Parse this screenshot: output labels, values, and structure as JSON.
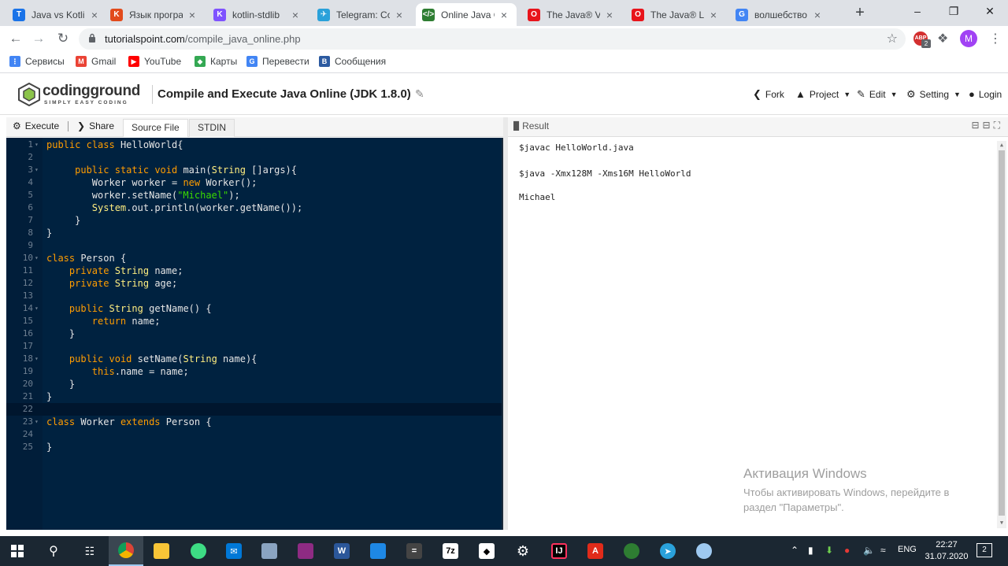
{
  "browser": {
    "tabs": [
      {
        "title": "Java vs Kotlin",
        "color": "#1a73e8",
        "glyph": "T"
      },
      {
        "title": "Язык програм",
        "color": "#e24a1b",
        "glyph": "K"
      },
      {
        "title": "kotlin-stdlib",
        "color": "#7f52ff",
        "glyph": "K"
      },
      {
        "title": "Telegram: Con",
        "color": "#2aa1da",
        "glyph": "✈"
      },
      {
        "title": "Online Java Co",
        "color": "#2e7d32",
        "glyph": "</>"
      },
      {
        "title": "The Java® Virt",
        "color": "#e8141b",
        "glyph": "O"
      },
      {
        "title": "The Java® Lan",
        "color": "#e8141b",
        "glyph": "O"
      },
      {
        "title": "волшебство k",
        "color": "#4285f4",
        "glyph": "G"
      }
    ],
    "url_host": "tutorialspoint.com",
    "url_path": "/compile_java_online.php",
    "bookmarks": [
      {
        "label": "Сервисы",
        "color": "#4285f4",
        "glyph": "⋮"
      },
      {
        "label": "Gmail",
        "color": "#ea4335",
        "glyph": "M"
      },
      {
        "label": "YouTube",
        "color": "#ff0000",
        "glyph": "▶"
      },
      {
        "label": "Карты",
        "color": "#34a853",
        "glyph": "◆"
      },
      {
        "label": "Перевести",
        "color": "#4285f4",
        "glyph": "G"
      },
      {
        "label": "Сообщения",
        "color": "#2c5aa0",
        "glyph": "В"
      }
    ],
    "extension_badge": "2",
    "profile_initial": "M"
  },
  "site": {
    "logo_name": "codingground",
    "logo_tagline": "SIMPLY EASY CODING",
    "page_title": "Compile and Execute Java Online (JDK 1.8.0)",
    "menu": {
      "fork": "Fork",
      "project": "Project",
      "edit": "Edit",
      "setting": "Setting",
      "login": "Login"
    }
  },
  "editor_toolbar": {
    "execute": "Execute",
    "share": "Share",
    "source_file": "Source File",
    "stdin": "STDIN"
  },
  "code_lines": [
    "public class HelloWorld{",
    "",
    "     public static void main(String []args){",
    "        Worker worker = new Worker();",
    "        worker.setName(\"Michael\");",
    "        System.out.println(worker.getName());",
    "     }",
    "}",
    "",
    "class Person {",
    "    private String name;",
    "    private String age;",
    "",
    "    public String getName() {",
    "        return name;",
    "    }",
    "",
    "    public void setName(String name){",
    "        this.name = name;",
    "    }",
    "}",
    "",
    "class Worker extends Person {",
    "",
    "}"
  ],
  "current_line": 22,
  "foldable_lines": [
    1,
    3,
    10,
    14,
    18,
    23
  ],
  "result": {
    "title": "Result",
    "lines": [
      "$javac HelloWorld.java",
      "$java -Xmx128M -Xms16M HelloWorld",
      "Michael"
    ]
  },
  "watermark": {
    "title": "Активация Windows",
    "text": "Чтобы активировать Windows, перейдите в раздел \"Параметры\"."
  },
  "taskbar": {
    "language": "ENG",
    "time": "22:27",
    "date": "31.07.2020",
    "notifications": "2"
  }
}
